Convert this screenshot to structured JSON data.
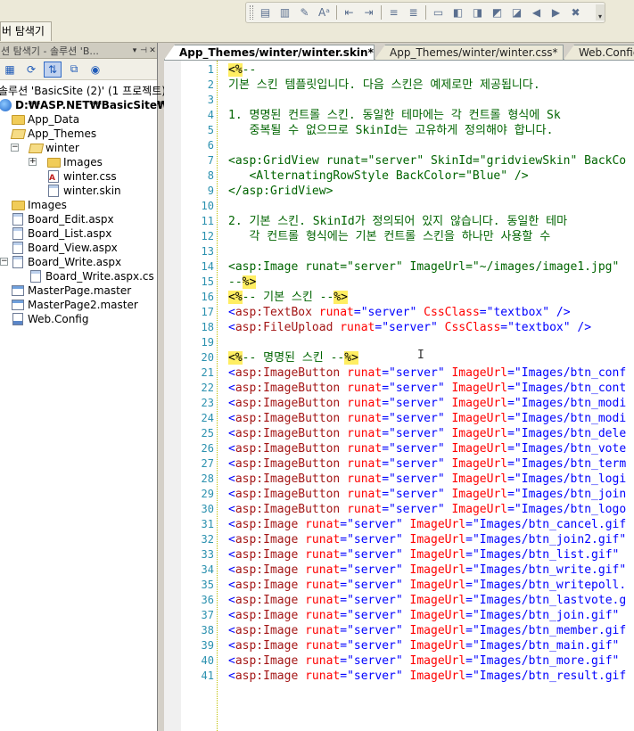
{
  "left_panel_tab": "버 탐색기",
  "explorer": {
    "title": "션 탐색기 - 솔루션 'B...",
    "pin": "▾ ✦ ✕",
    "tree": [
      {
        "label": "솔루션 'BasicSite (2)' (1 프로젝트)",
        "icon": "solution-icon"
      },
      {
        "label": "D:₩ASP.NET₩BasicSite₩",
        "icon": "website-icon",
        "bold": true
      },
      {
        "label": "App_Data",
        "icon": "folder-icon"
      },
      {
        "label": "App_Themes",
        "icon": "folder-open-icon"
      },
      {
        "label": "winter",
        "icon": "folder-open-icon",
        "expander": "−"
      },
      {
        "label": "Images",
        "icon": "folder-icon",
        "expander": "+"
      },
      {
        "label": "winter.css",
        "icon": "css-file-icon"
      },
      {
        "label": "winter.skin",
        "icon": "skin-file-icon"
      },
      {
        "label": "Images",
        "icon": "folder-icon"
      },
      {
        "label": "Board_Edit.aspx",
        "icon": "aspx-file-icon"
      },
      {
        "label": "Board_List.aspx",
        "icon": "aspx-file-icon"
      },
      {
        "label": "Board_View.aspx",
        "icon": "aspx-file-icon"
      },
      {
        "label": "Board_Write.aspx",
        "icon": "aspx-file-icon",
        "expander": "−"
      },
      {
        "label": "Board_Write.aspx.cs",
        "icon": "cs-file-icon"
      },
      {
        "label": "MasterPage.master",
        "icon": "master-file-icon"
      },
      {
        "label": "MasterPage2.master",
        "icon": "master-file-icon"
      },
      {
        "label": "Web.Config",
        "icon": "config-file-icon"
      }
    ]
  },
  "tabs": [
    {
      "label": "App_Themes/winter/winter.skin*",
      "active": true
    },
    {
      "label": "App_Themes/winter/winter.css*",
      "active": false
    },
    {
      "label": "Web.Config",
      "active": false
    }
  ],
  "code_lines": [
    {
      "n": "1",
      "parts": [
        [
          "delim",
          "<%"
        ],
        [
          "comment",
          "--"
        ]
      ]
    },
    {
      "n": "2",
      "parts": [
        [
          "comment",
          "기본 스킨 템플릿입니다. 다음 스킨은 예제로만 제공됩니다."
        ]
      ]
    },
    {
      "n": "3",
      "parts": []
    },
    {
      "n": "4",
      "parts": [
        [
          "comment",
          "1. 명명된 컨트롤 스킨. 동일한 테마에는 각 컨트롤 형식에 Sk"
        ]
      ]
    },
    {
      "n": "5",
      "parts": [
        [
          "comment",
          "   중복될 수 없으므로 SkinId는 고유하게 정의해야 합니다."
        ]
      ]
    },
    {
      "n": "6",
      "parts": []
    },
    {
      "n": "7",
      "parts": [
        [
          "comment",
          "<asp:GridView runat=\"server\" SkinId=\"gridviewSkin\" BackCo"
        ]
      ]
    },
    {
      "n": "8",
      "parts": [
        [
          "comment",
          "   <AlternatingRowStyle BackColor=\"Blue\" />"
        ]
      ]
    },
    {
      "n": "9",
      "parts": [
        [
          "comment",
          "</asp:GridView>"
        ]
      ]
    },
    {
      "n": "10",
      "parts": []
    },
    {
      "n": "11",
      "parts": [
        [
          "comment",
          "2. 기본 스킨. SkinId가 정의되어 있지 않습니다. 동일한 테마"
        ]
      ]
    },
    {
      "n": "12",
      "parts": [
        [
          "comment",
          "   각 컨트롤 형식에는 기본 컨트롤 스킨을 하나만 사용할 수"
        ]
      ]
    },
    {
      "n": "13",
      "parts": []
    },
    {
      "n": "14",
      "parts": [
        [
          "comment",
          "<asp:Image runat=\"server\" ImageUrl=\"~/images/image1.jpg\" "
        ]
      ]
    },
    {
      "n": "15",
      "parts": [
        [
          "comment",
          "--"
        ],
        [
          "delim",
          "%>"
        ]
      ]
    },
    {
      "n": "16",
      "parts": [
        [
          "delim",
          "<%"
        ],
        [
          "comment",
          "-- 기본 스킨 --"
        ],
        [
          "delim",
          "%>"
        ]
      ]
    },
    {
      "n": "17",
      "parts": [
        [
          "tag",
          "<"
        ],
        [
          "elem",
          "asp:TextBox"
        ],
        [
          "text",
          " "
        ],
        [
          "attr",
          "runat"
        ],
        [
          "tag",
          "=\"server\""
        ],
        [
          "text",
          " "
        ],
        [
          "attr",
          "CssClass"
        ],
        [
          "tag",
          "=\"textbox\""
        ],
        [
          "text",
          " "
        ],
        [
          "tag",
          "/>"
        ]
      ]
    },
    {
      "n": "18",
      "parts": [
        [
          "tag",
          "<"
        ],
        [
          "elem",
          "asp:FileUpload"
        ],
        [
          "text",
          " "
        ],
        [
          "attr",
          "runat"
        ],
        [
          "tag",
          "=\"server\""
        ],
        [
          "text",
          " "
        ],
        [
          "attr",
          "CssClass"
        ],
        [
          "tag",
          "=\"textbox\""
        ],
        [
          "text",
          " "
        ],
        [
          "tag",
          "/>"
        ]
      ]
    },
    {
      "n": "19",
      "parts": []
    },
    {
      "n": "20",
      "parts": [
        [
          "delim",
          "<%"
        ],
        [
          "comment",
          "-- 명명된 스킨 --"
        ],
        [
          "delim",
          "%>"
        ]
      ]
    },
    {
      "n": "21",
      "parts": [
        [
          "tag",
          "<"
        ],
        [
          "elem",
          "asp:ImageButton"
        ],
        [
          "text",
          " "
        ],
        [
          "attr",
          "runat"
        ],
        [
          "tag",
          "=\"server\""
        ],
        [
          "text",
          " "
        ],
        [
          "attr",
          "ImageUrl"
        ],
        [
          "tag",
          "=\"Images/btn_conf"
        ]
      ]
    },
    {
      "n": "22",
      "parts": [
        [
          "tag",
          "<"
        ],
        [
          "elem",
          "asp:ImageButton"
        ],
        [
          "text",
          " "
        ],
        [
          "attr",
          "runat"
        ],
        [
          "tag",
          "=\"server\""
        ],
        [
          "text",
          " "
        ],
        [
          "attr",
          "ImageUrl"
        ],
        [
          "tag",
          "=\"Images/btn_cont"
        ]
      ]
    },
    {
      "n": "23",
      "parts": [
        [
          "tag",
          "<"
        ],
        [
          "elem",
          "asp:ImageButton"
        ],
        [
          "text",
          " "
        ],
        [
          "attr",
          "runat"
        ],
        [
          "tag",
          "=\"server\""
        ],
        [
          "text",
          " "
        ],
        [
          "attr",
          "ImageUrl"
        ],
        [
          "tag",
          "=\"Images/btn_modi"
        ]
      ]
    },
    {
      "n": "24",
      "parts": [
        [
          "tag",
          "<"
        ],
        [
          "elem",
          "asp:ImageButton"
        ],
        [
          "text",
          " "
        ],
        [
          "attr",
          "runat"
        ],
        [
          "tag",
          "=\"server\""
        ],
        [
          "text",
          " "
        ],
        [
          "attr",
          "ImageUrl"
        ],
        [
          "tag",
          "=\"Images/btn_modi"
        ]
      ]
    },
    {
      "n": "25",
      "parts": [
        [
          "tag",
          "<"
        ],
        [
          "elem",
          "asp:ImageButton"
        ],
        [
          "text",
          " "
        ],
        [
          "attr",
          "runat"
        ],
        [
          "tag",
          "=\"server\""
        ],
        [
          "text",
          " "
        ],
        [
          "attr",
          "ImageUrl"
        ],
        [
          "tag",
          "=\"Images/btn_dele"
        ]
      ]
    },
    {
      "n": "26",
      "parts": [
        [
          "tag",
          "<"
        ],
        [
          "elem",
          "asp:ImageButton"
        ],
        [
          "text",
          " "
        ],
        [
          "attr",
          "runat"
        ],
        [
          "tag",
          "=\"server\""
        ],
        [
          "text",
          " "
        ],
        [
          "attr",
          "ImageUrl"
        ],
        [
          "tag",
          "=\"Images/btn_vote"
        ]
      ]
    },
    {
      "n": "27",
      "parts": [
        [
          "tag",
          "<"
        ],
        [
          "elem",
          "asp:ImageButton"
        ],
        [
          "text",
          " "
        ],
        [
          "attr",
          "runat"
        ],
        [
          "tag",
          "=\"server\""
        ],
        [
          "text",
          " "
        ],
        [
          "attr",
          "ImageUrl"
        ],
        [
          "tag",
          "=\"Images/btn_term"
        ]
      ]
    },
    {
      "n": "28",
      "parts": [
        [
          "tag",
          "<"
        ],
        [
          "elem",
          "asp:ImageButton"
        ],
        [
          "text",
          " "
        ],
        [
          "attr",
          "runat"
        ],
        [
          "tag",
          "=\"server\""
        ],
        [
          "text",
          " "
        ],
        [
          "attr",
          "ImageUrl"
        ],
        [
          "tag",
          "=\"Images/btn_logi"
        ]
      ]
    },
    {
      "n": "29",
      "parts": [
        [
          "tag",
          "<"
        ],
        [
          "elem",
          "asp:ImageButton"
        ],
        [
          "text",
          " "
        ],
        [
          "attr",
          "runat"
        ],
        [
          "tag",
          "=\"server\""
        ],
        [
          "text",
          " "
        ],
        [
          "attr",
          "ImageUrl"
        ],
        [
          "tag",
          "=\"Images/btn_join"
        ]
      ]
    },
    {
      "n": "30",
      "parts": [
        [
          "tag",
          "<"
        ],
        [
          "elem",
          "asp:ImageButton"
        ],
        [
          "text",
          " "
        ],
        [
          "attr",
          "runat"
        ],
        [
          "tag",
          "=\"server\""
        ],
        [
          "text",
          " "
        ],
        [
          "attr",
          "ImageUrl"
        ],
        [
          "tag",
          "=\"Images/btn_logo"
        ]
      ]
    },
    {
      "n": "31",
      "parts": [
        [
          "tag",
          "<"
        ],
        [
          "elem",
          "asp:Image"
        ],
        [
          "text",
          " "
        ],
        [
          "attr",
          "runat"
        ],
        [
          "tag",
          "=\"server\""
        ],
        [
          "text",
          " "
        ],
        [
          "attr",
          "ImageUrl"
        ],
        [
          "tag",
          "=\"Images/btn_cancel.gif"
        ]
      ]
    },
    {
      "n": "32",
      "parts": [
        [
          "tag",
          "<"
        ],
        [
          "elem",
          "asp:Image"
        ],
        [
          "text",
          " "
        ],
        [
          "attr",
          "runat"
        ],
        [
          "tag",
          "=\"server\""
        ],
        [
          "text",
          " "
        ],
        [
          "attr",
          "ImageUrl"
        ],
        [
          "tag",
          "=\"Images/btn_join2.gif\""
        ]
      ]
    },
    {
      "n": "33",
      "parts": [
        [
          "tag",
          "<"
        ],
        [
          "elem",
          "asp:Image"
        ],
        [
          "text",
          " "
        ],
        [
          "attr",
          "runat"
        ],
        [
          "tag",
          "=\"server\""
        ],
        [
          "text",
          " "
        ],
        [
          "attr",
          "ImageUrl"
        ],
        [
          "tag",
          "=\"Images/btn_list.gif\" "
        ]
      ]
    },
    {
      "n": "34",
      "parts": [
        [
          "tag",
          "<"
        ],
        [
          "elem",
          "asp:Image"
        ],
        [
          "text",
          " "
        ],
        [
          "attr",
          "runat"
        ],
        [
          "tag",
          "=\"server\""
        ],
        [
          "text",
          " "
        ],
        [
          "attr",
          "ImageUrl"
        ],
        [
          "tag",
          "=\"Images/btn_write.gif\""
        ]
      ]
    },
    {
      "n": "35",
      "parts": [
        [
          "tag",
          "<"
        ],
        [
          "elem",
          "asp:Image"
        ],
        [
          "text",
          " "
        ],
        [
          "attr",
          "runat"
        ],
        [
          "tag",
          "=\"server\""
        ],
        [
          "text",
          " "
        ],
        [
          "attr",
          "ImageUrl"
        ],
        [
          "tag",
          "=\"Images/btn_writepoll."
        ]
      ]
    },
    {
      "n": "36",
      "parts": [
        [
          "tag",
          "<"
        ],
        [
          "elem",
          "asp:Image"
        ],
        [
          "text",
          " "
        ],
        [
          "attr",
          "runat"
        ],
        [
          "tag",
          "=\"server\""
        ],
        [
          "text",
          " "
        ],
        [
          "attr",
          "ImageUrl"
        ],
        [
          "tag",
          "=\"Images/btn_lastvote.g"
        ]
      ]
    },
    {
      "n": "37",
      "parts": [
        [
          "tag",
          "<"
        ],
        [
          "elem",
          "asp:Image"
        ],
        [
          "text",
          " "
        ],
        [
          "attr",
          "runat"
        ],
        [
          "tag",
          "=\"server\""
        ],
        [
          "text",
          " "
        ],
        [
          "attr",
          "ImageUrl"
        ],
        [
          "tag",
          "=\"Images/btn_join.gif\" "
        ]
      ]
    },
    {
      "n": "38",
      "parts": [
        [
          "tag",
          "<"
        ],
        [
          "elem",
          "asp:Image"
        ],
        [
          "text",
          " "
        ],
        [
          "attr",
          "runat"
        ],
        [
          "tag",
          "=\"server\""
        ],
        [
          "text",
          " "
        ],
        [
          "attr",
          "ImageUrl"
        ],
        [
          "tag",
          "=\"Images/btn_member.gif"
        ]
      ]
    },
    {
      "n": "39",
      "parts": [
        [
          "tag",
          "<"
        ],
        [
          "elem",
          "asp:Image"
        ],
        [
          "text",
          " "
        ],
        [
          "attr",
          "runat"
        ],
        [
          "tag",
          "=\"server\""
        ],
        [
          "text",
          " "
        ],
        [
          "attr",
          "ImageUrl"
        ],
        [
          "tag",
          "=\"Images/btn_main.gif\" "
        ]
      ]
    },
    {
      "n": "40",
      "parts": [
        [
          "tag",
          "<"
        ],
        [
          "elem",
          "asp:Image"
        ],
        [
          "text",
          " "
        ],
        [
          "attr",
          "runat"
        ],
        [
          "tag",
          "=\"server\""
        ],
        [
          "text",
          " "
        ],
        [
          "attr",
          "ImageUrl"
        ],
        [
          "tag",
          "=\"Images/btn_more.gif\" "
        ]
      ]
    },
    {
      "n": "41",
      "parts": [
        [
          "tag",
          "<"
        ],
        [
          "elem",
          "asp:Image"
        ],
        [
          "text",
          " "
        ],
        [
          "attr",
          "runat"
        ],
        [
          "tag",
          "=\"server\""
        ],
        [
          "text",
          " "
        ],
        [
          "attr",
          "ImageUrl"
        ],
        [
          "tag",
          "=\"Images/btn_result.gif"
        ]
      ]
    }
  ]
}
